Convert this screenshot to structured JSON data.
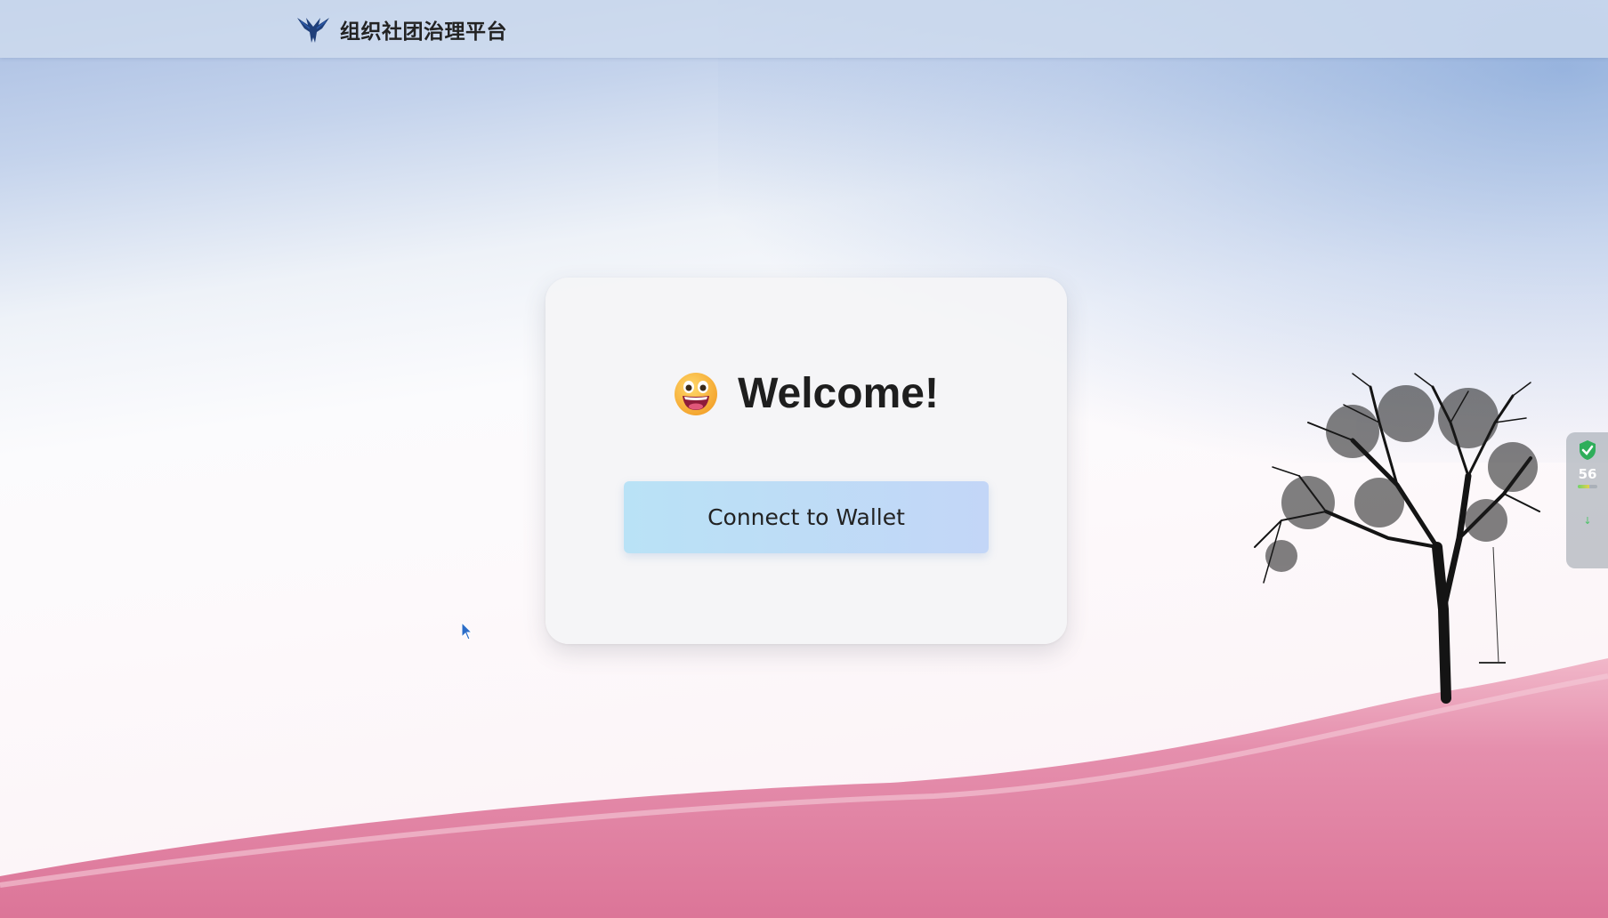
{
  "header": {
    "title": "组织社团治理平台",
    "logo_icon": "eagle-logo-icon"
  },
  "card": {
    "emoji_icon": "grinning-face-icon",
    "welcome_text": "Welcome!",
    "connect_button_label": "Connect to Wallet"
  },
  "system_monitor": {
    "icon": "shield-check-icon",
    "value": "56"
  },
  "colors": {
    "topbar": "#d0dcee",
    "button_start": "#b9e2f6",
    "button_end": "#c3d6f7",
    "hill": "#e07fa0",
    "text": "#1e1e1e"
  }
}
